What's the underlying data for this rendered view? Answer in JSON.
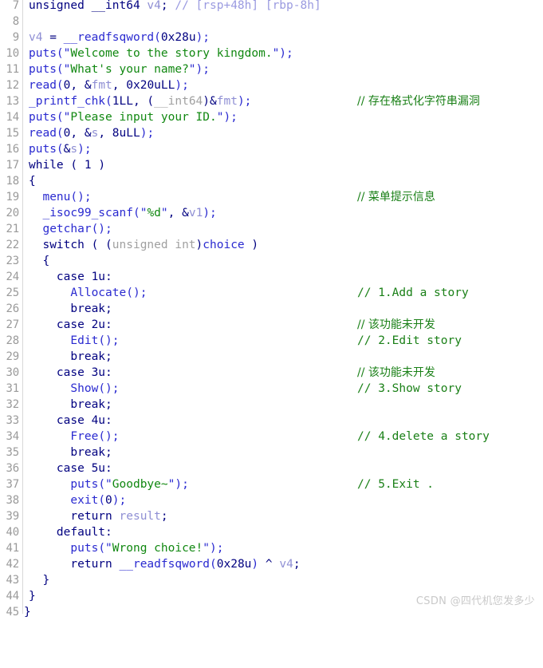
{
  "editor": {
    "kind": "ida-pseudocode-view",
    "first_line_number": 7,
    "last_line_number": 45
  },
  "watermark": {
    "text": "CSDN @四代机您发多少"
  },
  "colors": {
    "background": "#ffffff",
    "line_number": "#9a9a9a",
    "keyword": "#000080",
    "function": "#2a2ad0",
    "string": "#118811",
    "comment": "#1a8017",
    "local_variable": "#8f8fd4",
    "cast_gray": "#a0a0a0",
    "stack_comment": "#9a9ae0",
    "watermark": "#c9c9c9"
  },
  "lines": [
    {
      "n": "7",
      "code": "unsigned __int64 v4; // [rsp+48h] [rbp-8h]",
      "comment": ""
    },
    {
      "n": "8",
      "code": "",
      "comment": ""
    },
    {
      "n": "9",
      "code": "v4 = __readfsqword(0x28u);",
      "comment": ""
    },
    {
      "n": "10",
      "code": "puts(\"Welcome to the story kingdom.\");",
      "comment": ""
    },
    {
      "n": "11",
      "code": "puts(\"What's your name?\");",
      "comment": ""
    },
    {
      "n": "12",
      "code": "read(0, &fmt, 0x20uLL);",
      "comment": ""
    },
    {
      "n": "13",
      "code": "_printf_chk(1LL, (__int64)&fmt);",
      "comment": "// 存在格式化字符串漏洞"
    },
    {
      "n": "14",
      "code": "puts(\"Please input your ID.\");",
      "comment": ""
    },
    {
      "n": "15",
      "code": "read(0, &s, 8uLL);",
      "comment": ""
    },
    {
      "n": "16",
      "code": "puts(&s);",
      "comment": ""
    },
    {
      "n": "17",
      "code": "while ( 1 )",
      "comment": ""
    },
    {
      "n": "18",
      "code": "{",
      "comment": ""
    },
    {
      "n": "19",
      "code": "  menu();",
      "comment": "// 菜单提示信息"
    },
    {
      "n": "20",
      "code": "  _isoc99_scanf(\"%d\", &v1);",
      "comment": ""
    },
    {
      "n": "21",
      "code": "  getchar();",
      "comment": ""
    },
    {
      "n": "22",
      "code": "  switch ( (unsigned int)choice )",
      "comment": ""
    },
    {
      "n": "23",
      "code": "  {",
      "comment": ""
    },
    {
      "n": "24",
      "code": "    case 1u:",
      "comment": ""
    },
    {
      "n": "25",
      "code": "      Allocate();",
      "comment": "// 1.Add a story"
    },
    {
      "n": "26",
      "code": "      break;",
      "comment": ""
    },
    {
      "n": "27",
      "code": "    case 2u:",
      "comment": "// 该功能未开发"
    },
    {
      "n": "28",
      "code": "      Edit();",
      "comment": "// 2.Edit story"
    },
    {
      "n": "29",
      "code": "      break;",
      "comment": ""
    },
    {
      "n": "30",
      "code": "    case 3u:",
      "comment": "// 该功能未开发"
    },
    {
      "n": "31",
      "code": "      Show();",
      "comment": "// 3.Show story"
    },
    {
      "n": "32",
      "code": "      break;",
      "comment": ""
    },
    {
      "n": "33",
      "code": "    case 4u:",
      "comment": ""
    },
    {
      "n": "34",
      "code": "      Free();",
      "comment": "// 4.delete a story"
    },
    {
      "n": "35",
      "code": "      break;",
      "comment": ""
    },
    {
      "n": "36",
      "code": "    case 5u:",
      "comment": ""
    },
    {
      "n": "37",
      "code": "      puts(\"Goodbye~\");",
      "comment": "// 5.Exit ."
    },
    {
      "n": "38",
      "code": "      exit(0);",
      "comment": ""
    },
    {
      "n": "39",
      "code": "      return result;",
      "comment": ""
    },
    {
      "n": "40",
      "code": "    default:",
      "comment": ""
    },
    {
      "n": "41",
      "code": "      puts(\"Wrong choice!\");",
      "comment": ""
    },
    {
      "n": "42",
      "code": "      return __readfsqword(0x28u) ^ v4;",
      "comment": ""
    },
    {
      "n": "43",
      "code": "  }",
      "comment": ""
    },
    {
      "n": "44",
      "code": "}",
      "comment": ""
    },
    {
      "n": "45",
      "code": "}",
      "comment": ""
    }
  ]
}
